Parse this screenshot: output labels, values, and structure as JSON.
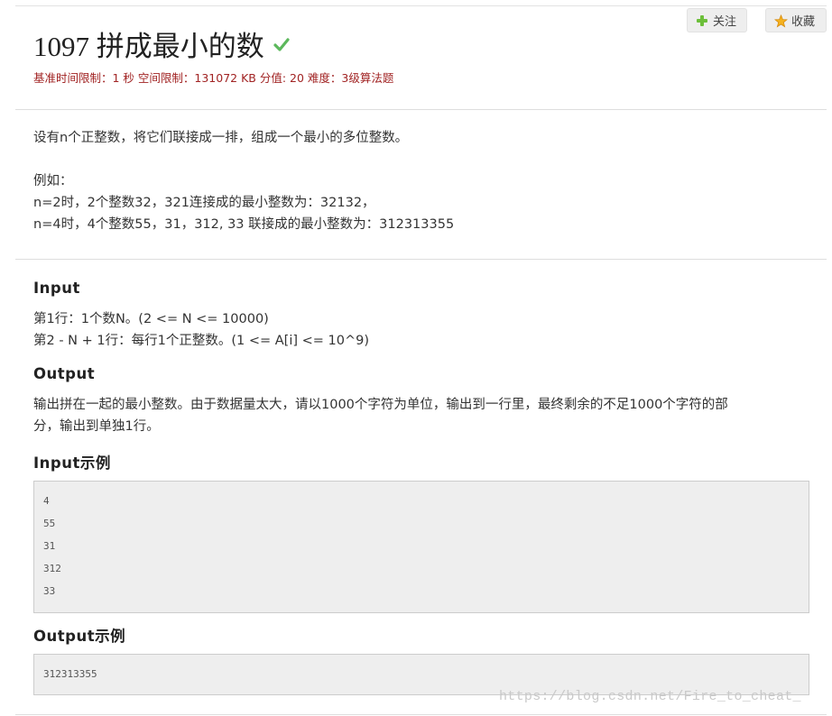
{
  "problem": {
    "title": "1097 拼成最小的数",
    "meta": "基准时间限制：1 秒 空间限制：131072 KB 分值: 20 难度：3级算法题"
  },
  "actions": {
    "follow_label": "关注",
    "collect_label": "收藏"
  },
  "description": {
    "lines": [
      "设有n个正整数，将它们联接成一排，组成一个最小的多位整数。",
      "例如：",
      "n=2时，2个整数32，321连接成的最小整数为：32132，",
      "n=4时，4个整数55，31，312, 33 联接成的最小整数为：312313355"
    ]
  },
  "input": {
    "title": "Input",
    "lines": [
      "第1行：1个数N。(2 <= N <= 10000)",
      "第2 - N + 1行：每行1个正整数。(1 <= A[i] <= 10^9)"
    ]
  },
  "output": {
    "title": "Output",
    "lines": [
      "输出拼在一起的最小整数。由于数据量太大，请以1000个字符为单位，输出到一行里，最终剩余的不足1000个字符的部",
      "分，输出到单独1行。"
    ]
  },
  "input_example": {
    "title": "Input示例",
    "lines": [
      "4",
      "55",
      "31",
      "312",
      "33"
    ]
  },
  "output_example": {
    "title": "Output示例",
    "lines": [
      "312313355"
    ]
  },
  "watermark": "https://blog.csdn.net/Fire_to_cheat_",
  "colors": {
    "meta_text": "#a12323",
    "check_green": "#5cb85c",
    "code_bg": "#eeeeee"
  },
  "icons": {
    "title_status": "check-icon",
    "follow": "plus-icon",
    "collect": "star-icon"
  }
}
